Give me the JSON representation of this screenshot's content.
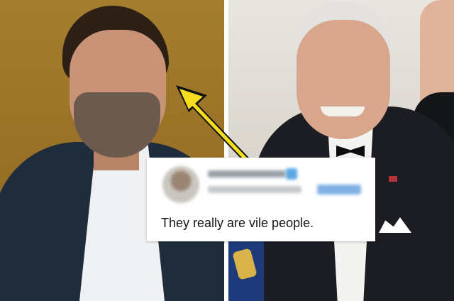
{
  "tweet": {
    "text": "They really are vile people."
  },
  "colors": {
    "arrow": "#f5dd1e",
    "card_background": "#ffffff",
    "left_background": "#a47e2e",
    "right_background": "#e9e6df"
  },
  "icons": {
    "arrow": "arrow-icon",
    "avatar": "blurred-avatar",
    "verified": "verified-badge-icon"
  }
}
